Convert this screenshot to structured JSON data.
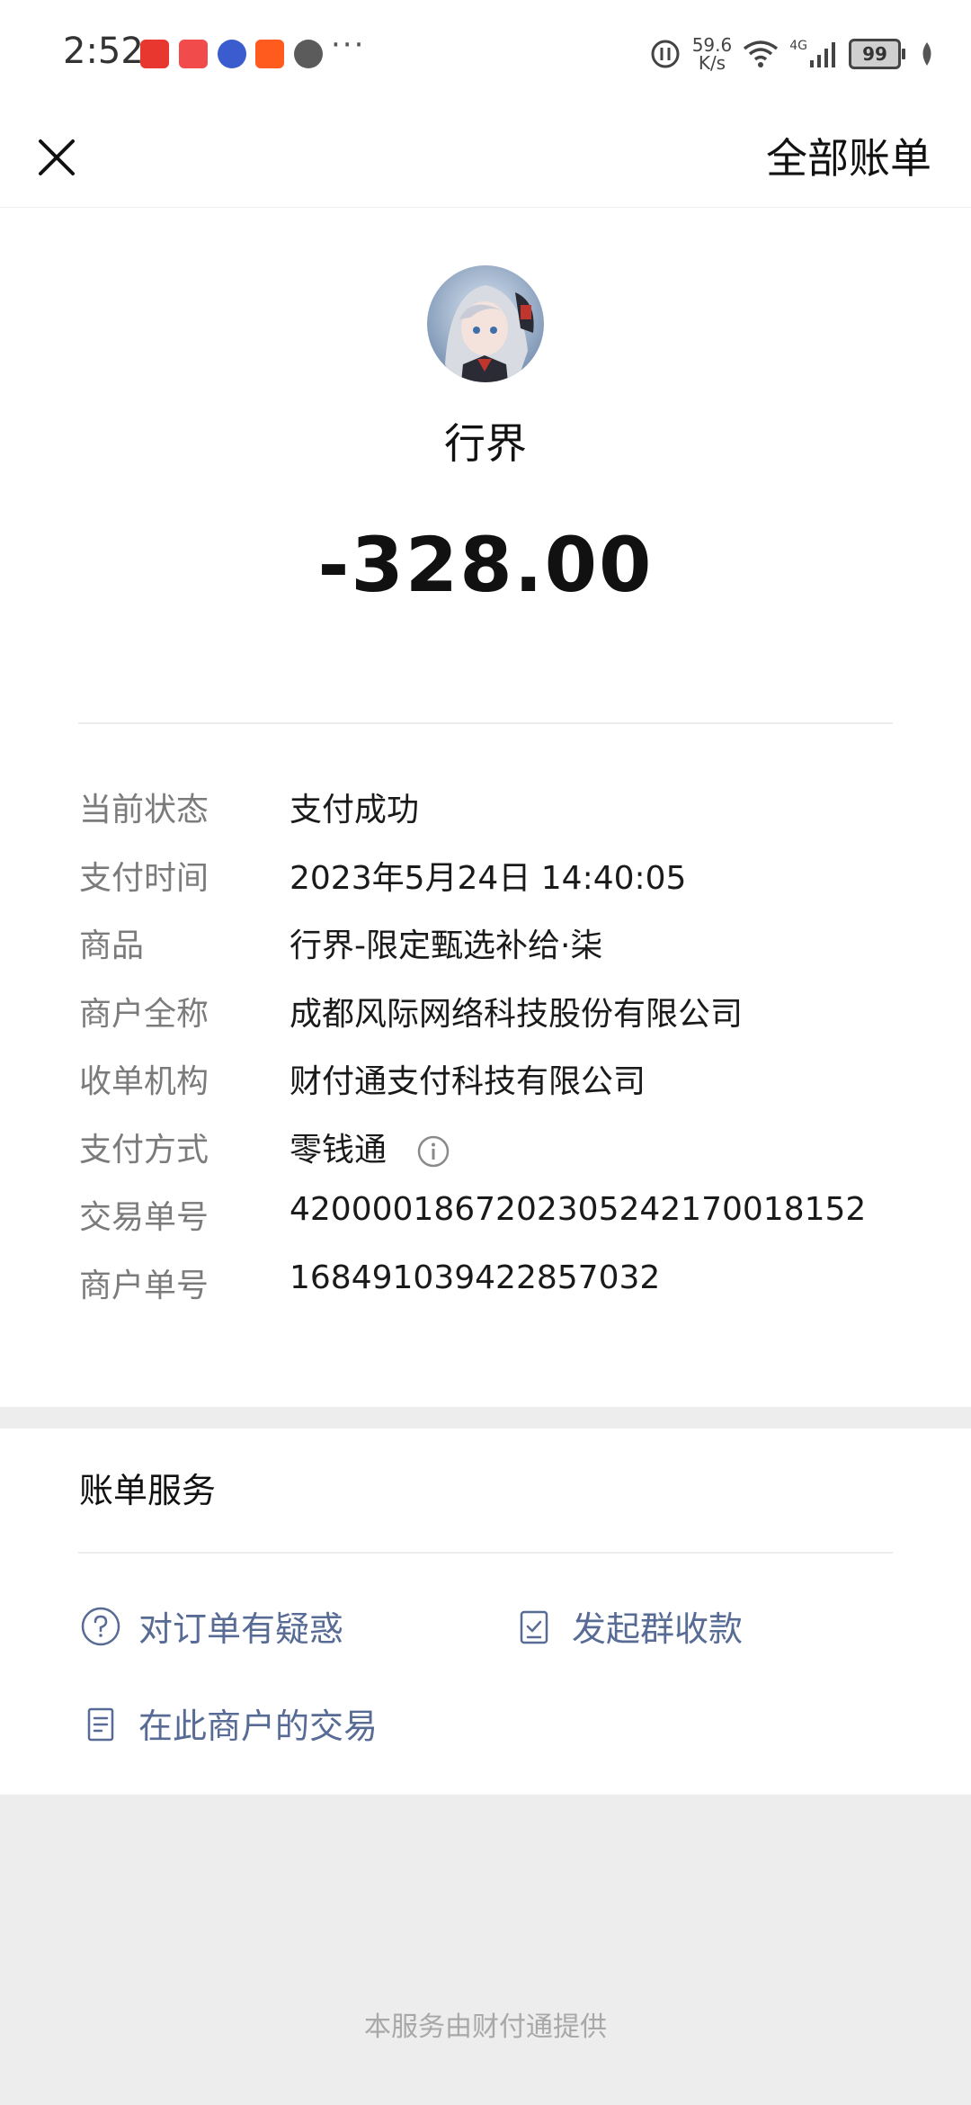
{
  "status_bar": {
    "time": "2:52",
    "net_speed": "59.6\nK/s",
    "signal_type": "4G",
    "battery": "99",
    "app_icons": [
      "hongbao-app-icon",
      "notes-app-icon",
      "tieba-app-icon",
      "taobao-app-icon",
      "chat-bubble-icon"
    ],
    "app_icon_colors": [
      "#e7372f",
      "#f24b4b",
      "#3a5ccf",
      "#ff5b1f",
      "#5b5b5b"
    ]
  },
  "nav": {
    "close_icon": "close-icon",
    "all_bills_label": "全部账单"
  },
  "transaction": {
    "merchant_name": "行界",
    "amount": "-328.00"
  },
  "details": [
    {
      "label": "当前状态",
      "value": "支付成功"
    },
    {
      "label": "支付时间",
      "value": "2023年5月24日 14:40:05"
    },
    {
      "label": "商品",
      "value": "行界-限定甄选补给·柒"
    },
    {
      "label": "商户全称",
      "value": "成都风际网络科技股份有限公司"
    },
    {
      "label": "收单机构",
      "value": "财付通支付科技有限公司"
    },
    {
      "label": "支付方式",
      "value": "零钱通"
    },
    {
      "label": "交易单号",
      "value": "4200001867202305242170018152"
    },
    {
      "label": "商户单号",
      "value": "168491039422857032"
    }
  ],
  "services": {
    "title": "账单服务",
    "links": [
      {
        "label": "对订单有疑惑",
        "icon": "question-icon"
      },
      {
        "label": "发起群收款",
        "icon": "group-collect-icon"
      },
      {
        "label": "在此商户的交易",
        "icon": "document-icon"
      }
    ]
  },
  "footer": "本服务由财付通提供",
  "colors": {
    "link": "#576b95",
    "label": "#7b7b7b",
    "background": "#ededed"
  }
}
